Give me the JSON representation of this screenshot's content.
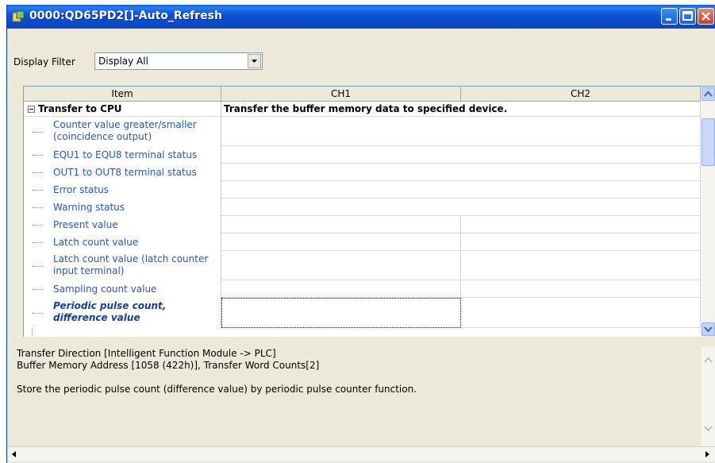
{
  "window": {
    "title": "0000:QD65PD2[]-Auto_Refresh"
  },
  "filter": {
    "label": "Display Filter",
    "selected": "Display All"
  },
  "grid": {
    "columns": [
      "Item",
      "CH1",
      "CH2"
    ],
    "group": {
      "label": "Transfer to CPU",
      "description": "Transfer the buffer memory data to specified device."
    },
    "items": [
      {
        "line1": "Counter value greater/smaller",
        "line2": "(coincidence output)"
      },
      {
        "line1": "EQU1 to EQU8 terminal status",
        "line2": ""
      },
      {
        "line1": "OUT1 to OUT8 terminal status",
        "line2": ""
      },
      {
        "line1": "Error status",
        "line2": ""
      },
      {
        "line1": "Warning status",
        "line2": ""
      },
      {
        "line1": "Present value",
        "line2": ""
      },
      {
        "line1": "Latch count value",
        "line2": ""
      },
      {
        "line1": "Latch count value (latch counter",
        "line2": "input terminal)"
      },
      {
        "line1": "Sampling count value",
        "line2": ""
      },
      {
        "line1": "Periodic pulse count,",
        "line2": "difference value"
      }
    ]
  },
  "description": {
    "line1": "Transfer Direction [Intelligent Function Module -> PLC]",
    "line2": "Buffer Memory Address [1058 (422h)], Transfer Word Counts[2]",
    "line3": "Store the periodic pulse count (difference value) by periodic pulse counter function."
  }
}
